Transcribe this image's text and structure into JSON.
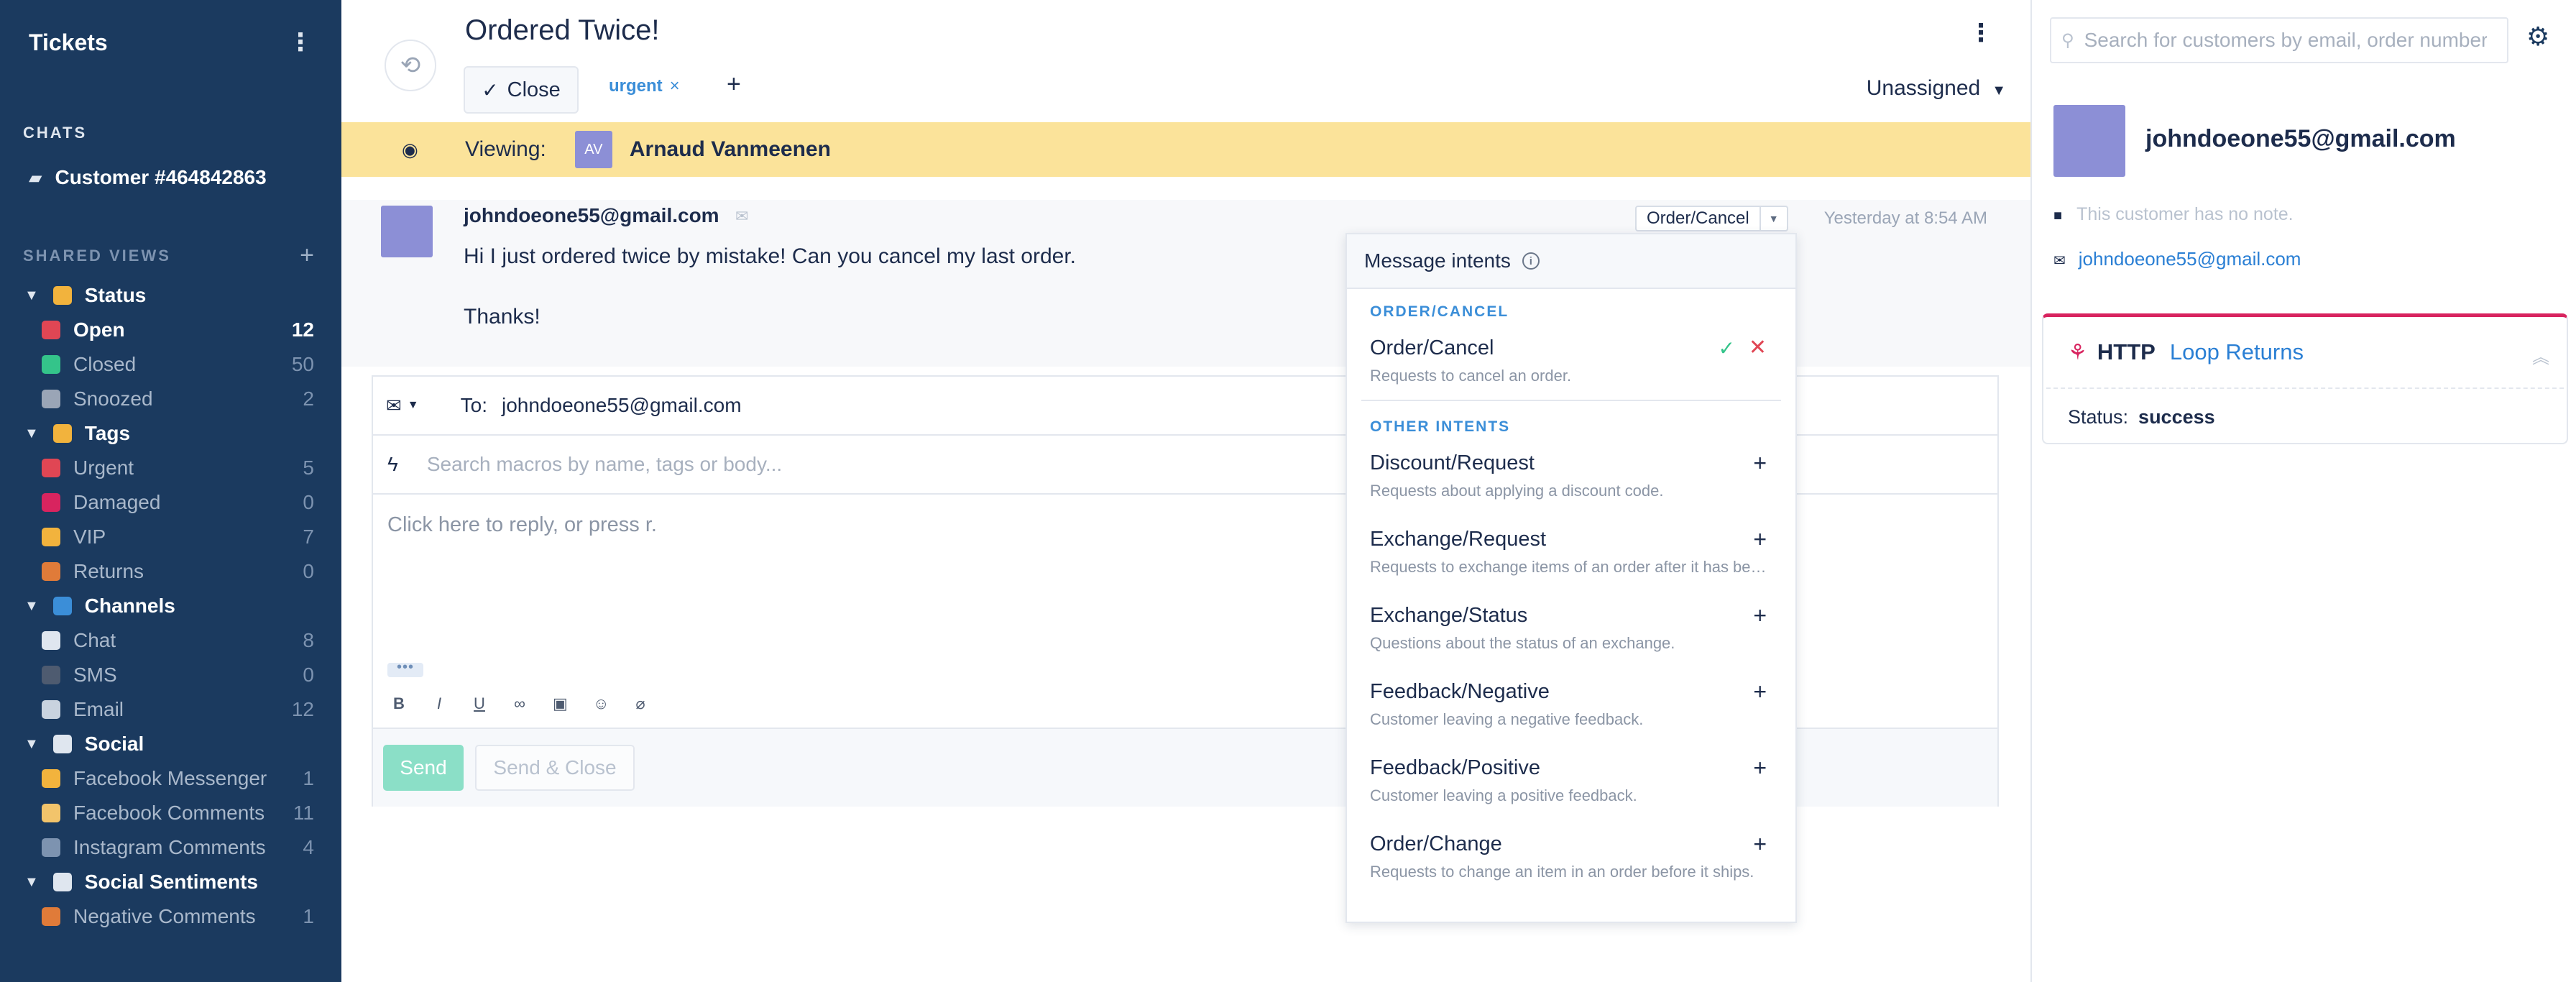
{
  "sidebar": {
    "title": "Tickets",
    "chats_section": "CHATS",
    "chat_item": "Customer #464842863",
    "shared_views_section": "SHARED VIEWS",
    "groups": [
      {
        "label": "Status",
        "icon": "traffic-light-icon",
        "color": "#f2b33d",
        "items": [
          {
            "label": "Open",
            "count": "12",
            "active": true,
            "color": "#e04654"
          },
          {
            "label": "Closed",
            "count": "50",
            "color": "#34c48a"
          },
          {
            "label": "Snoozed",
            "count": "2",
            "color": "#9aa5b6"
          }
        ]
      },
      {
        "label": "Tags",
        "icon": "ticket-tag-icon",
        "color": "#f2b33d",
        "items": [
          {
            "label": "Urgent",
            "count": "5",
            "color": "#e04654"
          },
          {
            "label": "Damaged",
            "count": "0",
            "color": "#d8245f"
          },
          {
            "label": "VIP",
            "count": "7",
            "color": "#f2b33d"
          },
          {
            "label": "Returns",
            "count": "0",
            "color": "#e07b39"
          }
        ]
      },
      {
        "label": "Channels",
        "icon": "mailbox-icon",
        "color": "#3b8ed8",
        "items": [
          {
            "label": "Chat",
            "count": "8",
            "color": "#dfe6ef"
          },
          {
            "label": "SMS",
            "count": "0",
            "color": "#4e5b70"
          },
          {
            "label": "Email",
            "count": "12",
            "color": "#c9d3df"
          }
        ]
      },
      {
        "label": "Social",
        "icon": "laptop-icon",
        "color": "#dfe6ef",
        "items": [
          {
            "label": "Facebook Messenger",
            "count": "1",
            "color": "#f2b33d"
          },
          {
            "label": "Facebook Comments",
            "count": "11",
            "color": "#f2c46b"
          },
          {
            "label": "Instagram Comments",
            "count": "4",
            "color": "#7d93b0"
          }
        ]
      },
      {
        "label": "Social Sentiments",
        "icon": "thought-bubble-icon",
        "color": "#dfe6ef",
        "items": [
          {
            "label": "Negative Comments",
            "count": "1",
            "color": "#e07b39"
          }
        ]
      }
    ]
  },
  "ticket": {
    "title": "Ordered Twice!",
    "close_label": "Close",
    "tag": "urgent",
    "assignee": "Unassigned",
    "viewing_label": "Viewing:",
    "viewer_initials": "AV",
    "viewer_name": "Arnaud Vanmeenen"
  },
  "message": {
    "from": "johndoeone55@gmail.com",
    "line1": "Hi I just ordered twice by mistake! Can you cancel my last order.",
    "line2": "Thanks!",
    "intent": "Order/Cancel",
    "time": "Yesterday at 8:54 AM"
  },
  "composer": {
    "to_label": "To:",
    "to_address": "johndoeone55@gmail.com",
    "macro_placeholder": "Search macros by name, tags or body...",
    "reply_placeholder": "Click here to reply, or press r.",
    "send_label": "Send",
    "send_close_label": "Send & Close"
  },
  "intents": {
    "title": "Message intents",
    "current_category": "ORDER/CANCEL",
    "current": {
      "name": "Order/Cancel",
      "desc": "Requests to cancel an order."
    },
    "other_category": "OTHER INTENTS",
    "others": [
      {
        "name": "Discount/Request",
        "desc": "Requests about applying a discount code."
      },
      {
        "name": "Exchange/Request",
        "desc": "Requests to exchange items of an order after it has been delivered."
      },
      {
        "name": "Exchange/Status",
        "desc": "Questions about the status of an exchange."
      },
      {
        "name": "Feedback/Negative",
        "desc": "Customer leaving a negative feedback."
      },
      {
        "name": "Feedback/Positive",
        "desc": "Customer leaving a positive feedback."
      },
      {
        "name": "Order/Change",
        "desc": "Requests to change an item in an order before it ships."
      }
    ]
  },
  "customer": {
    "search_placeholder": "Search for customers by email, order number...",
    "name": "johndoeone55@gmail.com",
    "note": "This customer has no note.",
    "email": "johndoeone55@gmail.com",
    "widget": {
      "type": "HTTP",
      "name": "Loop Returns",
      "status_label": "Status:",
      "status_value": "success"
    }
  },
  "colors": {
    "sidebar_bg": "#1b3a5f",
    "viewing_bg": "#fbe39a",
    "accent_blue": "#2a7fd4",
    "widget_accent": "#d8245f",
    "send_bg": "#8bdfc7"
  }
}
